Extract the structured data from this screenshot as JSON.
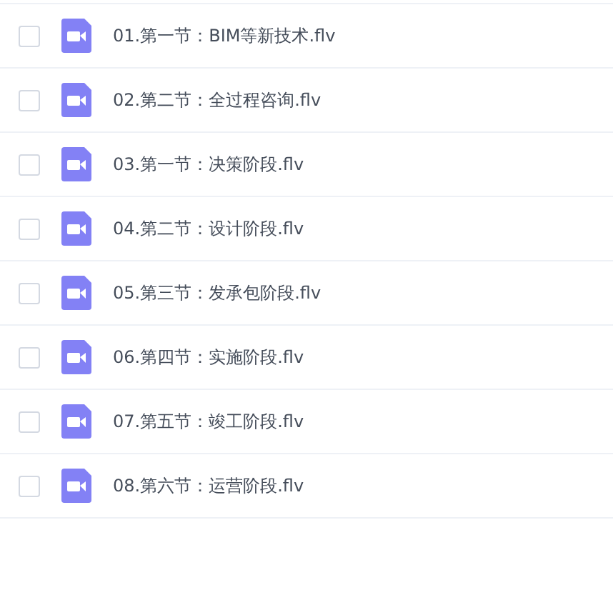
{
  "files": [
    {
      "name": "01.第一节：BIM等新技术.flv",
      "checked": false
    },
    {
      "name": "02.第二节：全过程咨询.flv",
      "checked": false
    },
    {
      "name": "03.第一节：决策阶段.flv",
      "checked": false
    },
    {
      "name": "04.第二节：设计阶段.flv",
      "checked": false
    },
    {
      "name": "05.第三节：发承包阶段.flv",
      "checked": false
    },
    {
      "name": "06.第四节：实施阶段.flv",
      "checked": false
    },
    {
      "name": "07.第五节：竣工阶段.flv",
      "checked": false
    },
    {
      "name": "08.第六节：运营阶段.flv",
      "checked": false
    }
  ]
}
